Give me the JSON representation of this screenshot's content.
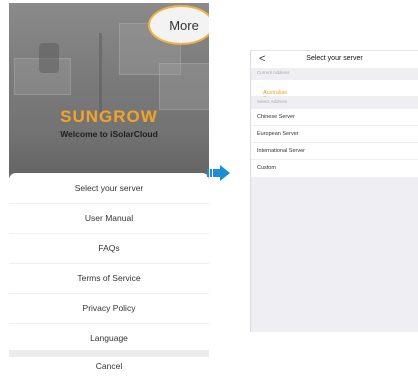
{
  "left_screen": {
    "more_label": "More",
    "brand": "SUNGROW",
    "welcome": "Welcome to iSolarCloud",
    "sheet_items": [
      {
        "label": "Select your server"
      },
      {
        "label": "User Manual"
      },
      {
        "label": "FAQs"
      },
      {
        "label": "Terms of Service"
      },
      {
        "label": "Privacy Policy"
      },
      {
        "label": "Language"
      }
    ],
    "cancel": "Cancel"
  },
  "right_screen": {
    "back": "<",
    "title": "Select your server",
    "current_header": "Current Address",
    "current_server": "Australian Server",
    "check": "✓",
    "select_header": "Select Address",
    "servers": [
      {
        "label": "Chinese Server"
      },
      {
        "label": "European Server"
      },
      {
        "label": "International Server"
      },
      {
        "label": "Custom"
      }
    ]
  },
  "colors": {
    "accent": "#f3a427",
    "highlight_ring": "#f0b340",
    "arrow": "#1d8dd8"
  }
}
